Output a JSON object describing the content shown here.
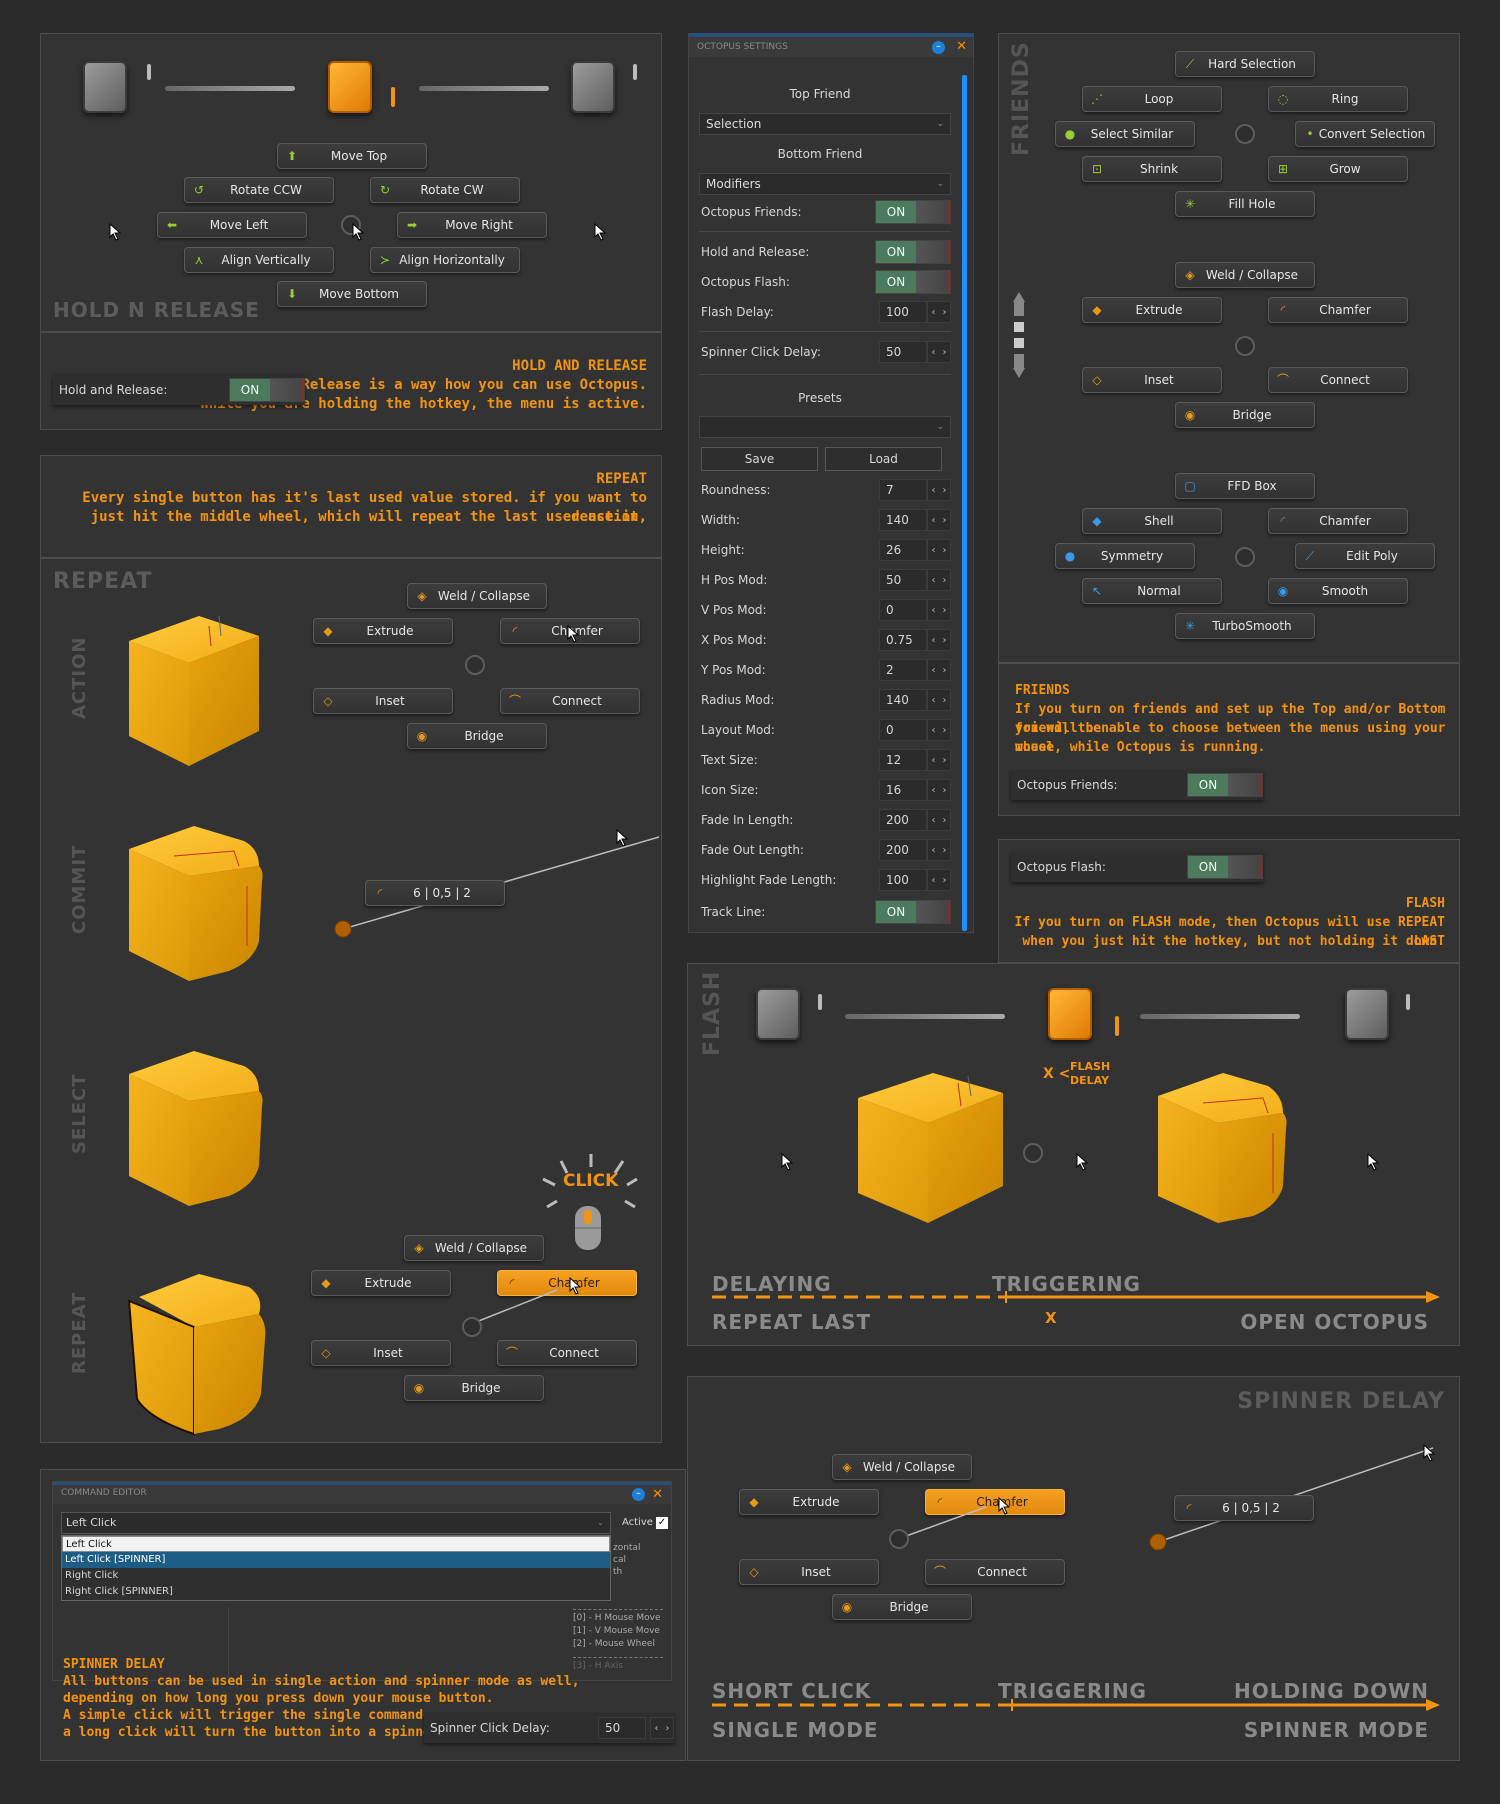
{
  "hold_release_panel": {
    "title": "HOLD N RELEASE",
    "buttons": {
      "move_top": "Move Top",
      "rotate_ccw": "Rotate CCW",
      "rotate_cw": "Rotate CW",
      "move_left": "Move Left",
      "move_right": "Move Right",
      "align_v": "Align Vertically",
      "align_h": "Align Horizontally",
      "move_bottom": "Move Bottom"
    }
  },
  "hold_release_info": {
    "heading": "HOLD AND RELEASE",
    "line1": "Hold n Release is a way how you can use Octopus.",
    "line2": "While you are holding the hotkey, the menu is active.",
    "setting_label": "Hold and Release:",
    "setting_value": "ON"
  },
  "repeat_info": {
    "heading": "REPEAT",
    "line1": "Every single button has it's last used value stored. if you want to reuse it,",
    "line2": "just hit the middle wheel, which will repeat the last used action."
  },
  "repeat_panel": {
    "title": "REPEAT",
    "stage_labels": [
      "ACTION",
      "COMMIT",
      "SELECT",
      "REPEAT"
    ],
    "weld": "Weld / Collapse",
    "extrude": "Extrude",
    "chamfer": "Chamfer",
    "inset": "Inset",
    "connect": "Connect",
    "bridge": "Bridge",
    "spinner_value": "6 | 0,5 | 2",
    "click_label": "CLICK"
  },
  "command_editor": {
    "title": "COMMAND EDITOR",
    "dropdown_value": "Left Click",
    "active_label": "Active",
    "options": [
      "Left Click",
      "Left Click [SPINNER]",
      "Right Click",
      "Right Click [SPINNER]"
    ],
    "side_text": [
      "zontal",
      "cal",
      "th"
    ],
    "mouse_items": [
      "[0] - H Mouse Move",
      "[1] - V Mouse Move",
      "[2] - Mouse Wheel",
      "[3] - H Axis"
    ],
    "info_heading": "SPINNER DELAY",
    "info_lines": [
      "All buttons can be used in single action and spinner mode as well,",
      "depending on how long you press down your mouse button.",
      "A simple click will trigger the single command,",
      "a long click will turn the button into a spinner."
    ],
    "spinner_label": "Spinner Click Delay:",
    "spinner_value": "50"
  },
  "settings": {
    "title": "OCTOPUS SETTINGS",
    "top_friend_label": "Top Friend",
    "top_friend_value": "Selection",
    "bottom_friend_label": "Bottom Friend",
    "bottom_friend_value": "Modifiers",
    "octopus_friends": "Octopus Friends:",
    "hold_release": "Hold and Release:",
    "octopus_flash": "Octopus Flash:",
    "on": "ON",
    "flash_delay": "Flash Delay:",
    "flash_delay_value": "100",
    "spinner_delay": "Spinner Click Delay:",
    "spinner_delay_value": "50",
    "presets_label": "Presets",
    "save": "Save",
    "load": "Load",
    "fields": [
      {
        "label": "Roundness:",
        "value": "7"
      },
      {
        "label": "Width:",
        "value": "140"
      },
      {
        "label": "Height:",
        "value": "26"
      },
      {
        "label": "H Pos Mod:",
        "value": "50"
      },
      {
        "label": "V Pos Mod:",
        "value": "0"
      },
      {
        "label": "X Pos Mod:",
        "value": "0.75"
      },
      {
        "label": "Y Pos Mod:",
        "value": "2"
      },
      {
        "label": "Radius Mod:",
        "value": "140"
      },
      {
        "label": "Layout Mod:",
        "value": "0"
      },
      {
        "label": "Text Size:",
        "value": "12"
      },
      {
        "label": "Icon Size:",
        "value": "16"
      },
      {
        "label": "Fade In Length:",
        "value": "200"
      },
      {
        "label": "Fade Out Length:",
        "value": "200"
      },
      {
        "label": "Highlight Fade Length:",
        "value": "100"
      }
    ],
    "track_line": "Track Line:"
  },
  "friends_panel": {
    "title": "FRIENDS",
    "top": {
      "hard_selection": "Hard Selection",
      "loop": "Loop",
      "ring": "Ring",
      "select_similar": "Select Similar",
      "convert_selection": "Convert Selection",
      "shrink": "Shrink",
      "grow": "Grow",
      "fill_hole": "Fill Hole"
    },
    "mid": {
      "weld": "Weld / Collapse",
      "extrude": "Extrude",
      "chamfer": "Chamfer",
      "inset": "Inset",
      "connect": "Connect",
      "bridge": "Bridge"
    },
    "bot": {
      "ffd": "FFD Box",
      "shell": "Shell",
      "chamfer": "Chamfer",
      "symmetry": "Symmetry",
      "edit_poly": "Edit Poly",
      "normal": "Normal",
      "smooth": "Smooth",
      "turbosmooth": "TurboSmooth"
    }
  },
  "friends_info": {
    "heading": "FRIENDS",
    "lines": [
      "If you turn on friends and set up the Top and/or Bottom friend, then",
      "you will be able to choose between the menus using your mouse",
      "wheel, while Octopus is running."
    ],
    "setting_label": "Octopus Friends:",
    "setting_value": "ON"
  },
  "flash_info": {
    "setting_label": "Octopus Flash:",
    "setting_value": "ON",
    "heading": "FLASH",
    "line1": "If you turn on FLASH mode, then Octopus will use REPEAT LAST",
    "line2": "when you just hit the hotkey, but not holding it down."
  },
  "flash_panel": {
    "title": "FLASH",
    "x_label": "X <",
    "flash_delay": "FLASH",
    "flash_delay2": "DELAY",
    "delaying": "DELAYING",
    "triggering": "TRIGGERING",
    "repeat_last": "REPEAT LAST",
    "open_octopus": "OPEN OCTOPUS",
    "x_mark": "X"
  },
  "spinner_panel": {
    "title": "SPINNER DELAY",
    "weld": "Weld / Collapse",
    "extrude": "Extrude",
    "chamfer": "Chamfer",
    "inset": "Inset",
    "connect": "Connect",
    "bridge": "Bridge",
    "spinner_value": "6 | 0,5 | 2",
    "short_click": "SHORT CLICK",
    "triggering": "TRIGGERING",
    "holding_down": "HOLDING DOWN",
    "single_mode": "SINGLE MODE",
    "spinner_mode": "SPINNER MODE"
  },
  "colors": {
    "accent": "#f29411",
    "bg": "#2b2b2c",
    "panel": "#333334",
    "on": "#4d7a5c",
    "scroll": "#1e90ff"
  }
}
